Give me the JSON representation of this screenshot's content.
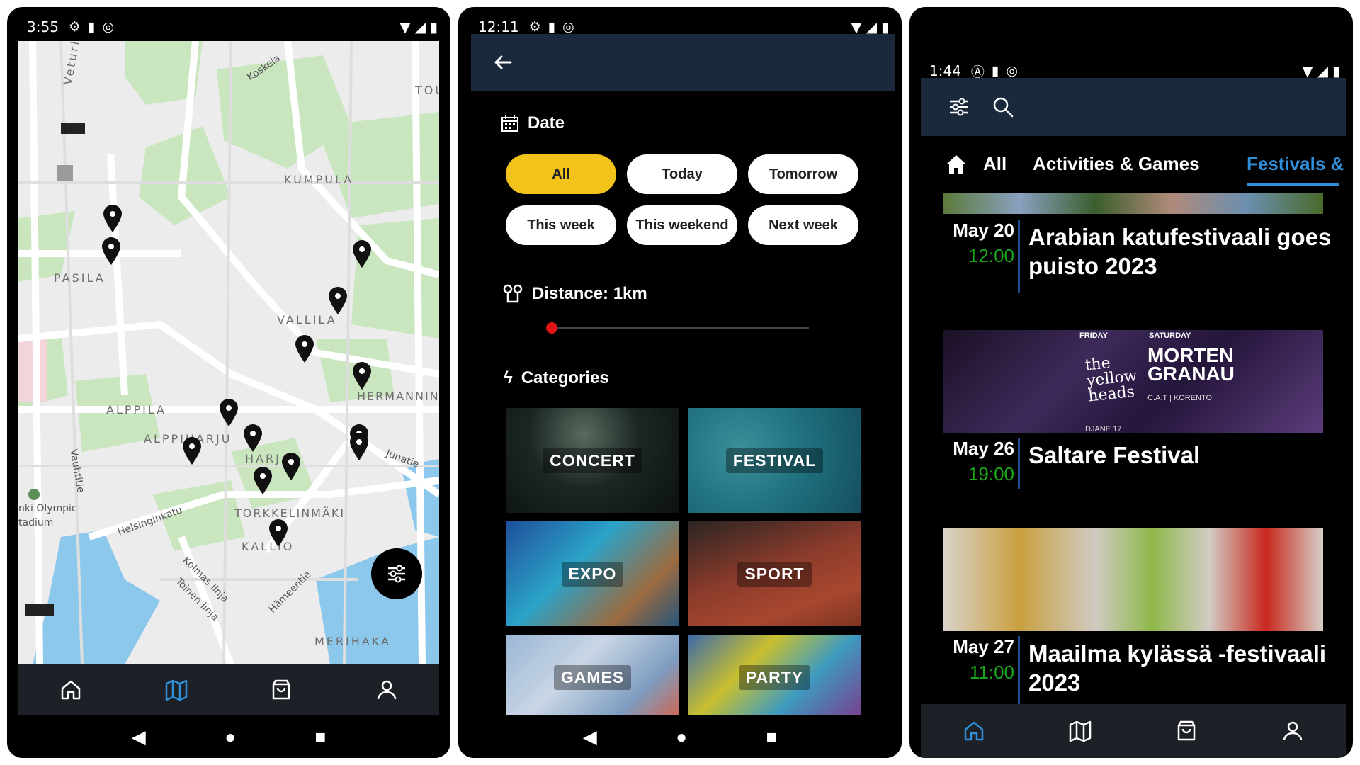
{
  "map_screen": {
    "status": {
      "time": "3:55"
    },
    "labels": {
      "kumpula": "KUMPULA",
      "pasila": "PASILA",
      "vallila": "VALLILA",
      "hermannin": "HERMANNIN",
      "alppila": "ALPPILA",
      "alppiharju": "ALPPIHARJU",
      "harju": "HARJ",
      "torkkelinmaki": "TORKKELINMÄKI",
      "kallio": "KALLIO",
      "merihaka": "MERIHAKA",
      "tou": "TOU"
    },
    "streets": {
      "veturitie": "Veturitie",
      "koskela": "Koskela",
      "vauhtitie": "Vauhtitie",
      "junatie": "Junatie",
      "helsinginkatu": "Helsinginkatu",
      "kolmas_linja": "Kolmas linja",
      "toinen_linja": "Toinen linja",
      "hameentie": "Hämeentie",
      "olympic": "nki Olympic",
      "stadium": "tadium"
    },
    "bottom_nav": [
      "home",
      "map",
      "shopping-bag",
      "profile"
    ]
  },
  "filter_screen": {
    "status": {
      "time": "12:11"
    },
    "date": {
      "title": "Date",
      "chips": [
        "All",
        "Today",
        "Tomorrow",
        "This week",
        "This weekend",
        "Next week"
      ],
      "selected": "All"
    },
    "distance": {
      "label": "Distance: 1km"
    },
    "categories": {
      "title": "Categories",
      "items": [
        "CONCERT",
        "FESTIVAL",
        "EXPO",
        "SPORT",
        "GAMES",
        "PARTY"
      ]
    },
    "colors": {
      "appbar": "#1a2a3c",
      "selected_chip": "#f2c31a",
      "slider_thumb": "#e01414"
    }
  },
  "events_screen": {
    "status": {
      "time": "1:44"
    },
    "tabs": {
      "all": "All",
      "activities": "Activities & Games",
      "festivals": "Festivals &"
    },
    "active_tab": "Festivals &",
    "events": [
      {
        "date": "May 20",
        "time": "12:00",
        "title": "Arabian katufestivaali goes puisto 2023"
      },
      {
        "date": "May 26",
        "time": "19:00",
        "title": "Saltare Festival"
      },
      {
        "date": "May 27",
        "time": "11:00",
        "title": "Maailma kylässä -festivaali 2023"
      }
    ],
    "poster": {
      "day1": "FRIDAY",
      "day2": "SATURDAY",
      "band": "the yellow heads",
      "headliner_line1": "MORTEN",
      "headliner_line2": "GRANAU",
      "support": "C.A.T | KORENTO",
      "dj": "DJANE 17"
    },
    "colors": {
      "accent": "#2f8fd8",
      "time": "#1aa51a"
    }
  }
}
